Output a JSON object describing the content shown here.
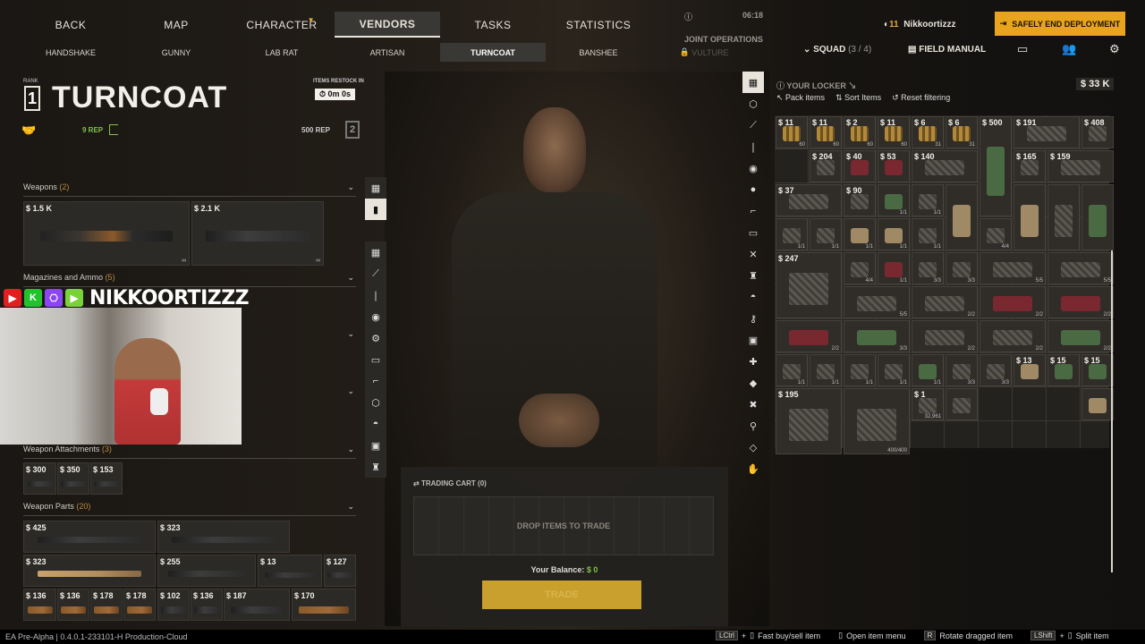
{
  "nav": {
    "tabs": [
      "BACK",
      "MAP",
      "CHARACTER",
      "VENDORS",
      "TASKS",
      "STATISTICS"
    ],
    "active": "VENDORS",
    "joint_ops_time": "06:18",
    "joint_ops_label": "JOINT OPERATIONS"
  },
  "vendors": {
    "tabs": [
      "HANDSHAKE",
      "GUNNY",
      "LAB RAT",
      "ARTISAN",
      "TURNCOAT",
      "BANSHEE",
      "VULTURE"
    ],
    "active": "TURNCOAT",
    "locked": "VULTURE"
  },
  "vendor": {
    "rank_label": "RANK",
    "rank": "1",
    "name": "TURNCOAT",
    "restock_label": "ITEMS RESTOCK IN",
    "restock_time": "0m 0s",
    "rep_current": "9 REP",
    "rep_next": "500 REP",
    "next_rank": "2"
  },
  "categories": {
    "weapons": {
      "label": "Weapons",
      "count": "(2)"
    },
    "mags": {
      "label": "Magazines and Ammo",
      "count": "(5)"
    },
    "attachments": {
      "label": "Weapon Attachments",
      "count": "(3)"
    },
    "parts": {
      "label": "Weapon Parts",
      "count": "(20)"
    }
  },
  "weapons": [
    {
      "price": "$ 1.5 K"
    },
    {
      "price": "$ 2.1 K"
    }
  ],
  "attachments": [
    {
      "price": "$ 300"
    },
    {
      "price": "$ 350"
    },
    {
      "price": "$ 153"
    }
  ],
  "parts_row1": [
    {
      "price": "$ 425"
    },
    {
      "price": "$ 323"
    }
  ],
  "parts_row2": [
    {
      "price": "$ 323"
    },
    {
      "price": "$ 255"
    },
    {
      "price": "$ 13"
    },
    {
      "price": "$ 127"
    }
  ],
  "parts_row3": [
    {
      "price": "$ 136"
    },
    {
      "price": "$ 136"
    },
    {
      "price": "$ 178"
    },
    {
      "price": "$ 178"
    },
    {
      "price": "$ 102"
    },
    {
      "price": "$ 136"
    },
    {
      "price": "$ 187"
    },
    {
      "price": "$ 170"
    }
  ],
  "stream": {
    "name": "NIKKOORTIZZZ"
  },
  "cart": {
    "title": "TRADING CART (0)",
    "drop": "DROP ITEMS TO TRADE",
    "balance_label": "Your Balance:",
    "balance_value": "$ 0",
    "trade": "TRADE"
  },
  "user": {
    "level": "11",
    "name": "Nikkoortizzz"
  },
  "end_deployment": "SAFELY END DEPLOYMENT",
  "squad": {
    "label": "SQUAD",
    "count": "(3 / 4)"
  },
  "field_manual": "FIELD MANUAL",
  "locker": {
    "title": "YOUR LOCKER",
    "total": "$ 33 K",
    "actions": [
      "Pack items",
      "Sort Items",
      "Reset filtering"
    ]
  },
  "locker_prices": [
    "$ 11",
    "$ 11",
    "$ 2",
    "$ 11",
    "$ 6",
    "$ 6",
    "$ 500",
    "$ 191",
    "$ 408",
    "$ 204",
    "$ 40",
    "$ 53",
    "$ 140",
    "$ 165",
    "$ 159",
    "$ 37",
    "$ 90",
    "$ 247",
    "$ 13",
    "$ 15",
    "$ 15",
    "$ 195",
    "$ 1"
  ],
  "footer": {
    "version": "EA Pre-Alpha | 0.4.0.1-233101-H Production-Cloud",
    "hints": [
      {
        "key": "LCtrl",
        "label": "Fast buy/sell item"
      },
      {
        "key": "",
        "label": "Open item menu"
      },
      {
        "key": "R",
        "label": "Rotate dragged item"
      },
      {
        "key": "LShift",
        "label": "Split item"
      }
    ]
  },
  "colors": {
    "accent": "#e8a41c",
    "rep": "#7fc24a",
    "warning": "#e0a93a"
  }
}
